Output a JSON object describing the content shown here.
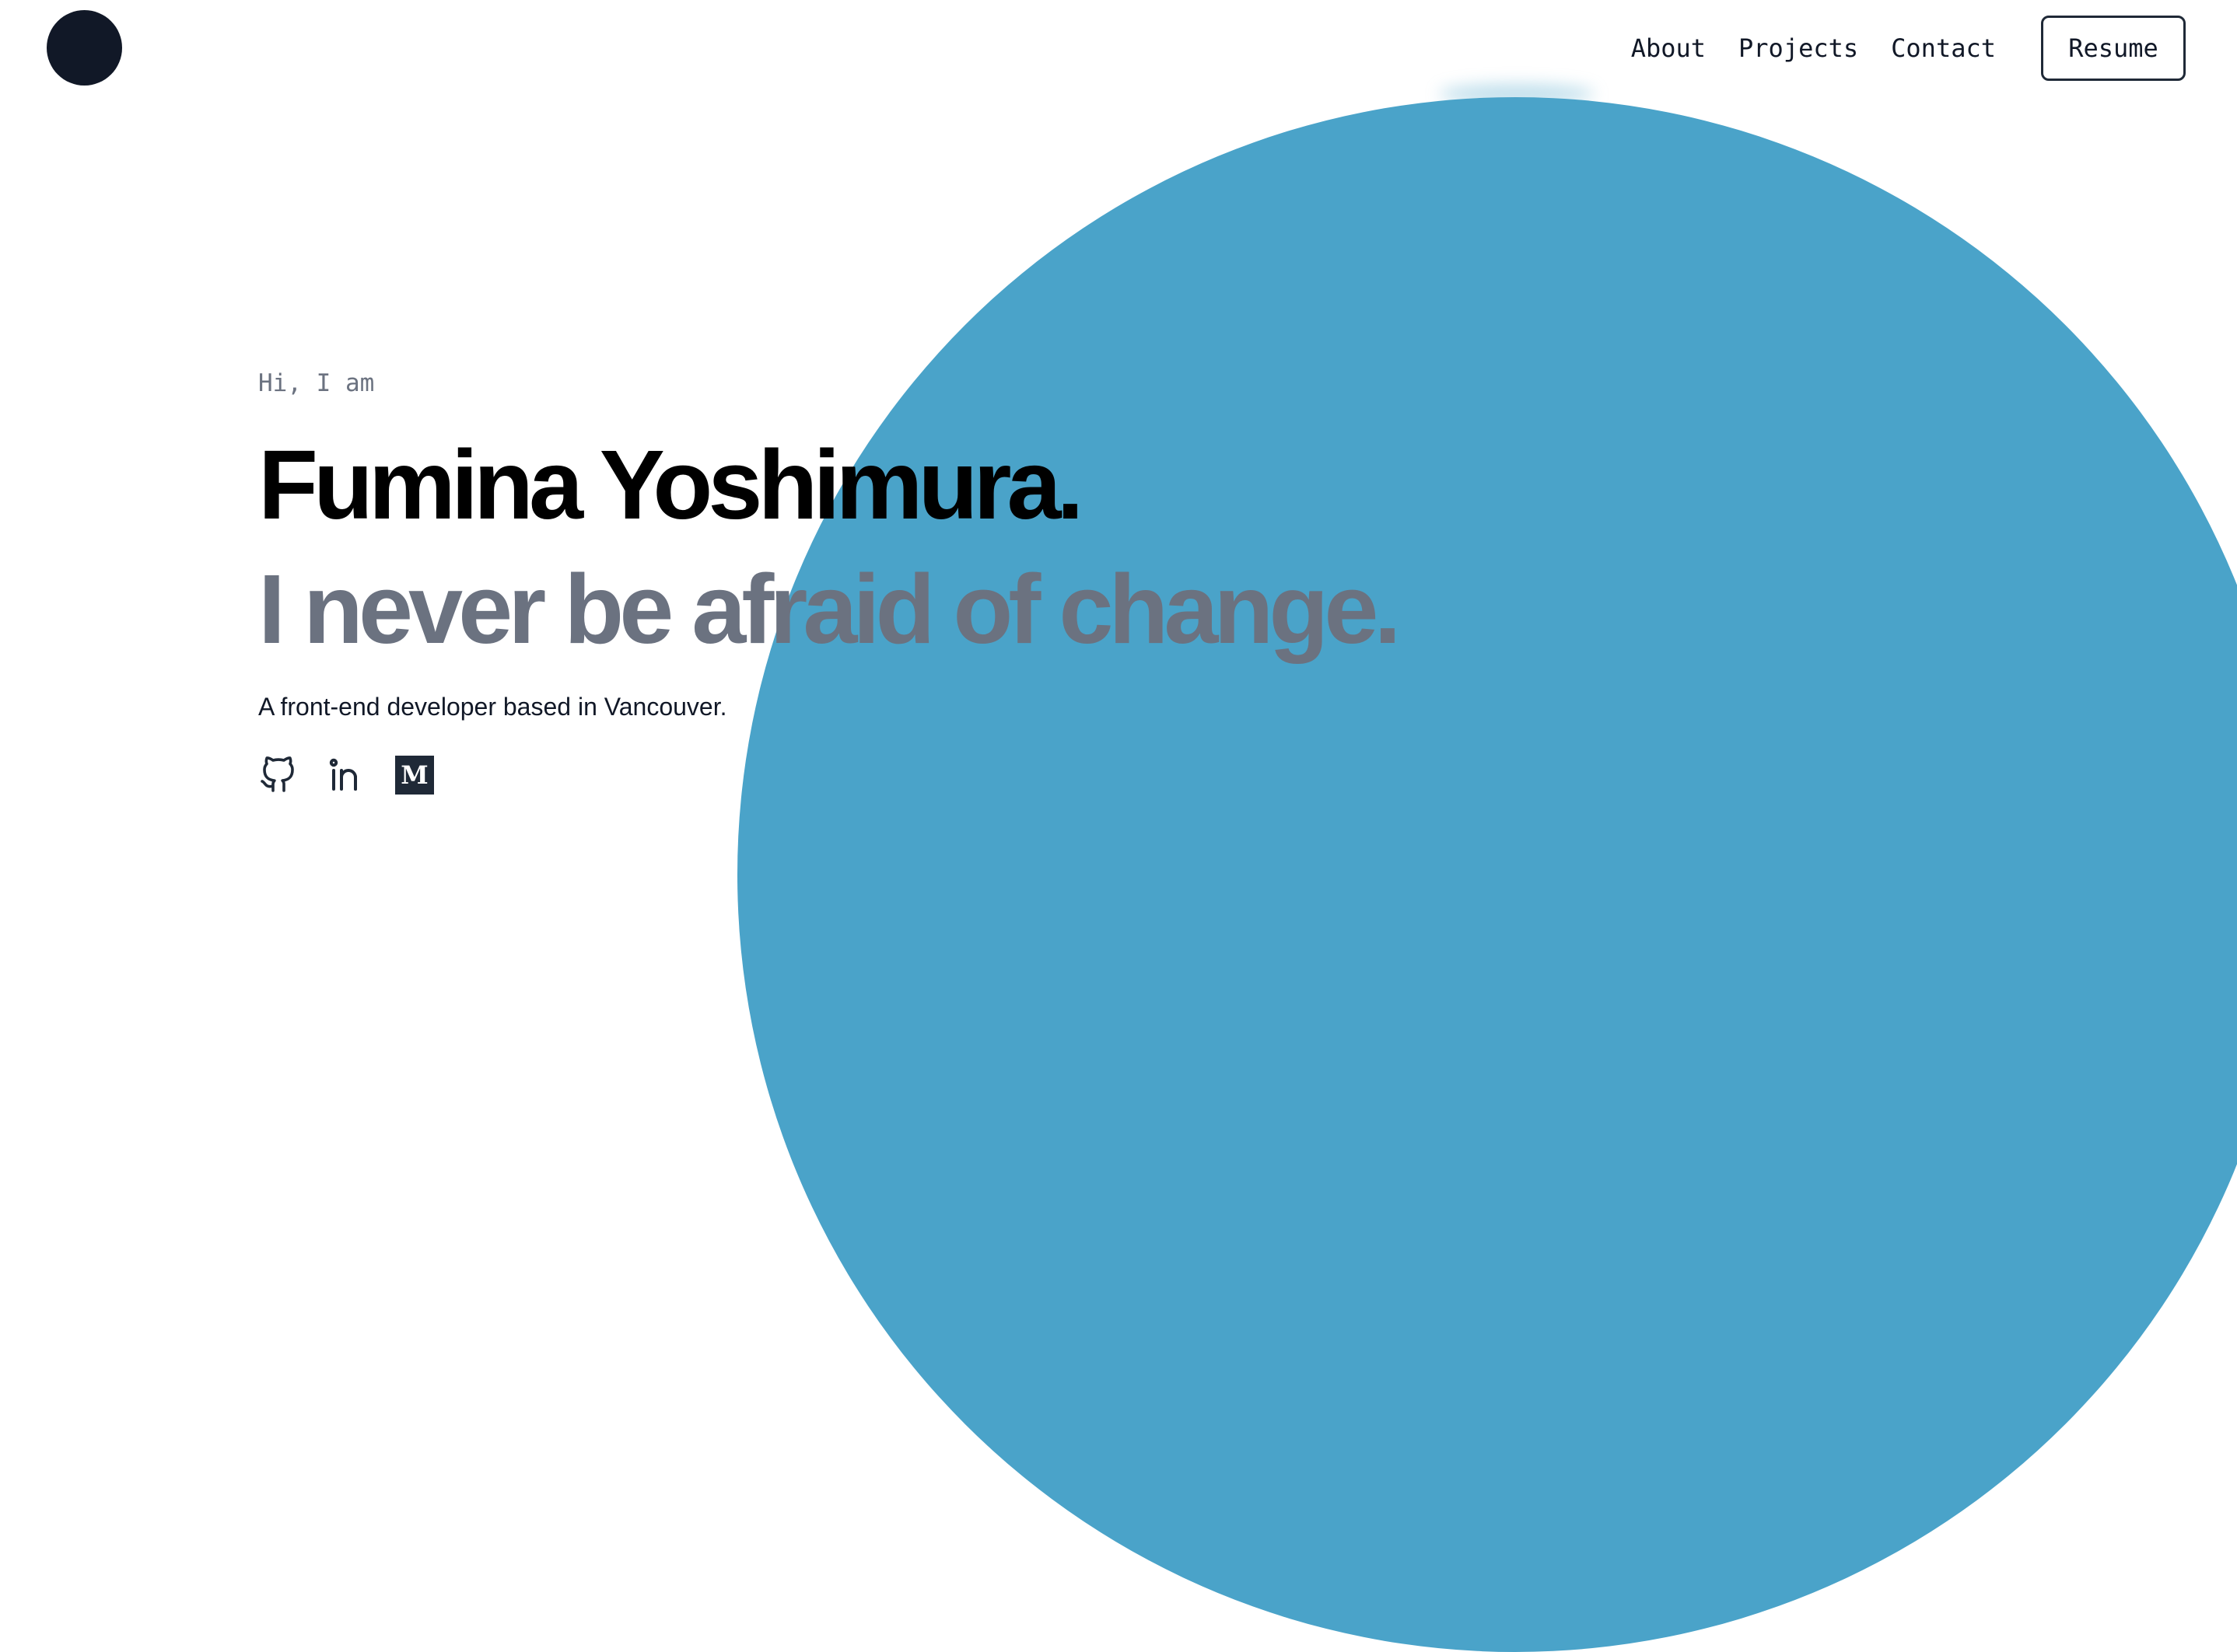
{
  "header": {
    "logo_icon": "dark-circle-logo",
    "nav": {
      "about": "About",
      "projects": "Projects",
      "contact": "Contact"
    },
    "resume_label": "Resume"
  },
  "hero": {
    "greeting": "Hi, I am",
    "name": "Fumina Yoshimura.",
    "tagline": "I never be afraid of change.",
    "subtitle": "A front-end developer based in Vancouver.",
    "socials": {
      "github_icon": "github-icon",
      "linkedin_icon": "linkedin-icon",
      "medium_icon": "medium-icon",
      "medium_glyph": "M"
    }
  },
  "colors": {
    "accent_circle": "#4aa3c9",
    "logo": "#111827",
    "heading": "#000000",
    "tagline": "#6b7280"
  }
}
